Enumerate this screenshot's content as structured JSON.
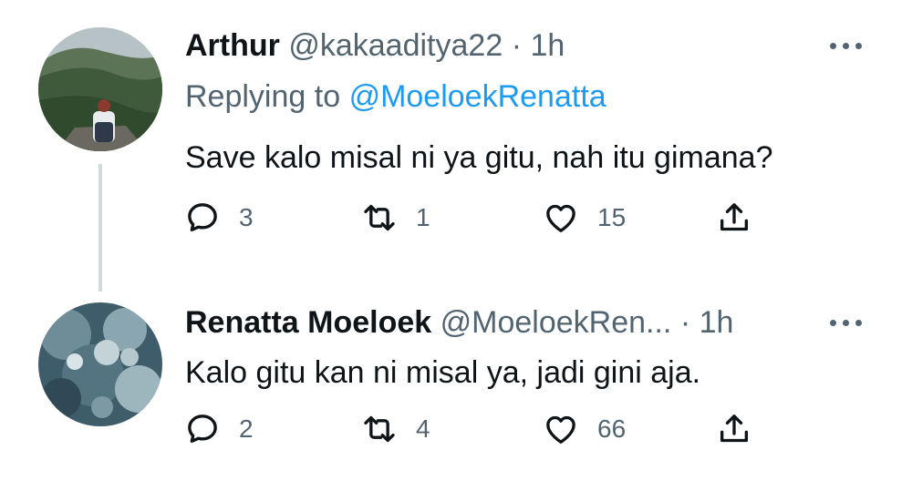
{
  "tweets": [
    {
      "avatar_icon": "avatar-mountain",
      "name": "Arthur",
      "handle": "@kakaaditya22",
      "separator": "·",
      "time": "1h",
      "replying_prefix": "Replying to",
      "replying_to": "@MoeloekRenatta",
      "text": "Save kalo misal ni ya gitu, nah itu gimana?",
      "replies": "3",
      "retweets": "1",
      "likes": "15"
    },
    {
      "avatar_icon": "avatar-water",
      "name": "Renatta Moeloek",
      "handle": "@MoeloekRen...",
      "separator": "·",
      "time": "1h",
      "text": "Kalo gitu kan ni misal ya, jadi gini aja.",
      "replies": "2",
      "retweets": "4",
      "likes": "66"
    }
  ],
  "colors": {
    "text": "#0f1419",
    "secondary": "#536471",
    "link": "#1d9bf0",
    "thread_line": "#cfd9de"
  }
}
